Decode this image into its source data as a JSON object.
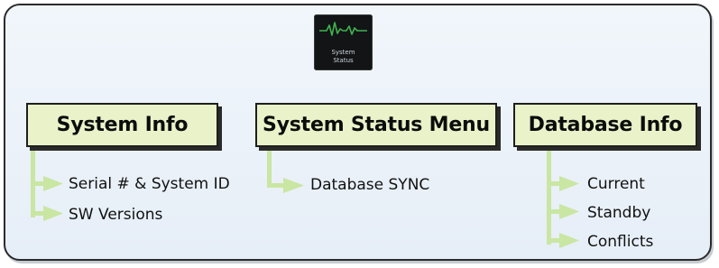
{
  "icon": {
    "name": "system-status-waveform-icon",
    "label_line1": "System",
    "label_line2": "Status"
  },
  "colors": {
    "header_fill": "#e9f2c9",
    "branch_green": "#c9e6a2",
    "panel_bg": "#eef4fa",
    "icon_bg": "#121416",
    "wave": "#3fb34f"
  },
  "menus": [
    {
      "title": "System Info",
      "items": [
        "Serial # & System ID",
        "SW Versions"
      ]
    },
    {
      "title": "System Status Menu",
      "items": [
        "Database SYNC"
      ]
    },
    {
      "title": "Database Info",
      "items": [
        "Current",
        "Standby",
        "Conflicts"
      ]
    }
  ]
}
